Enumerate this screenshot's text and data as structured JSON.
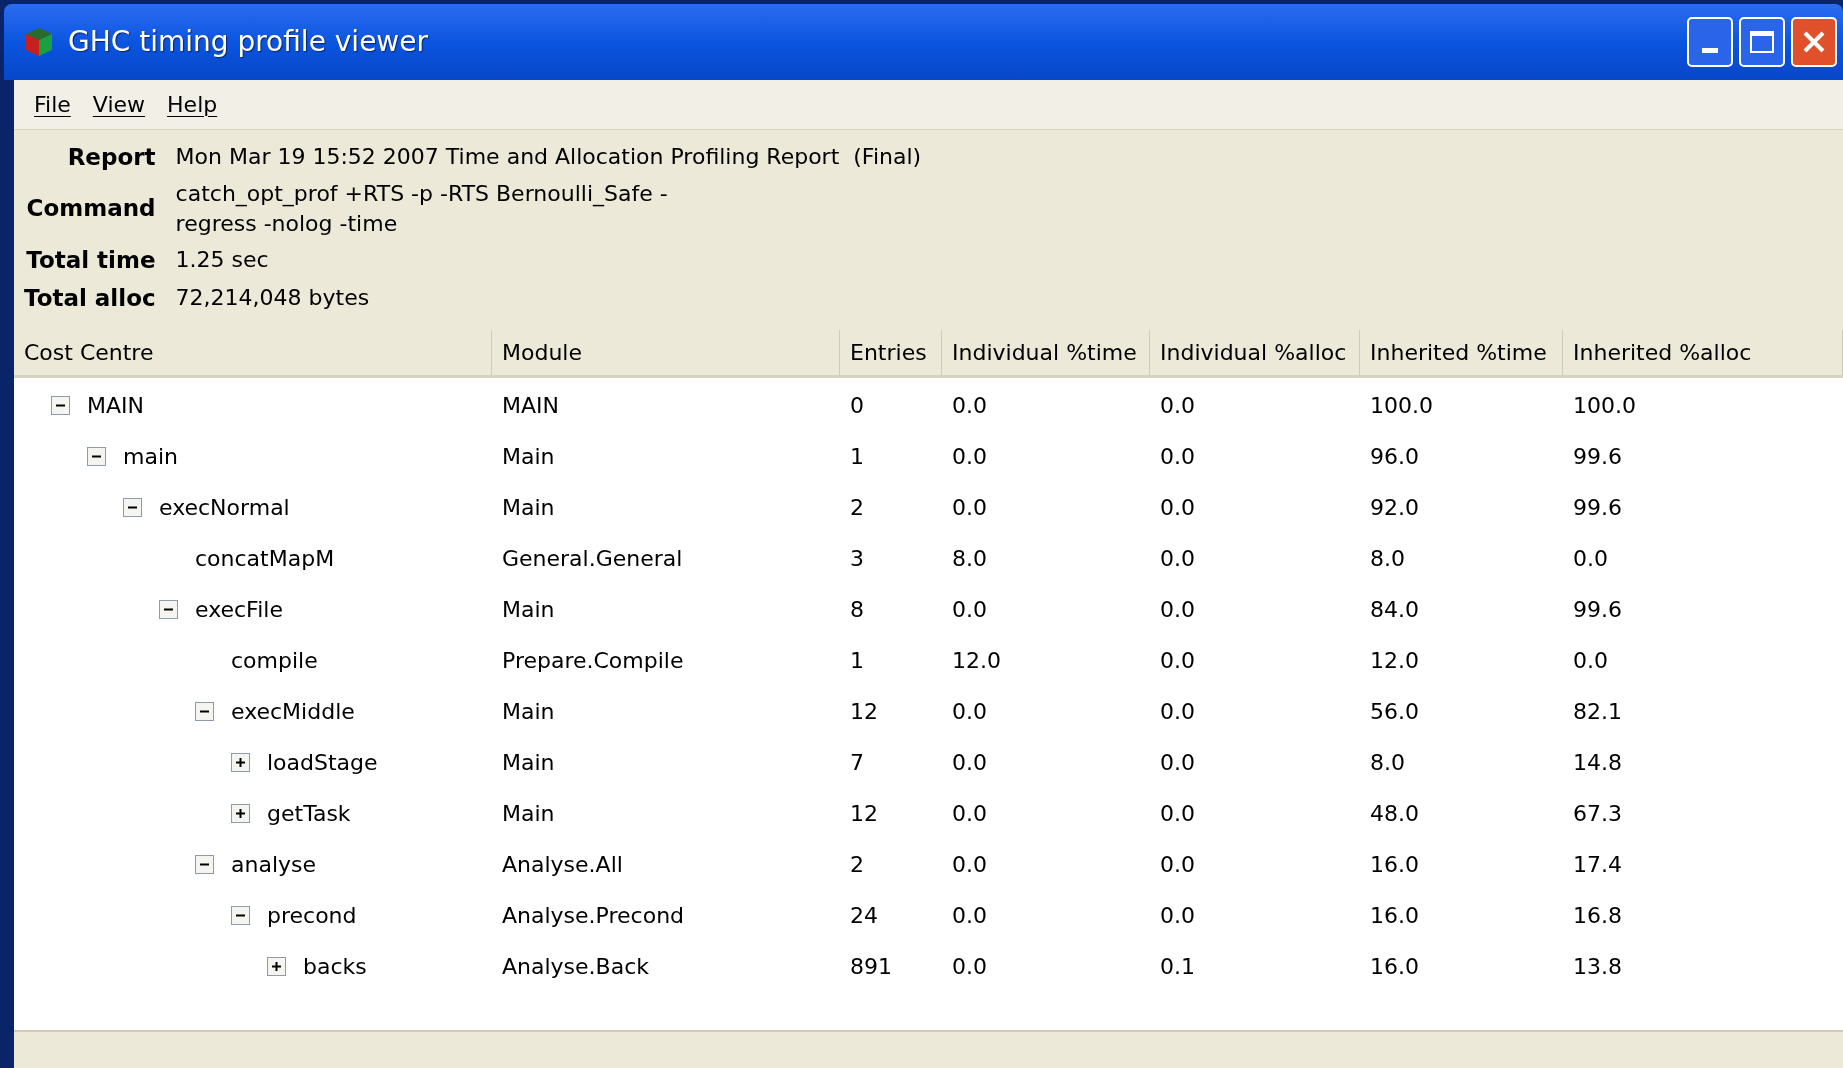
{
  "window": {
    "title": "GHC timing profile viewer"
  },
  "menu": [
    "File",
    "View",
    "Help"
  ],
  "report": [
    {
      "label": "Report",
      "value": "Mon Mar 19 15:52 2007 Time and Allocation Profiling Report  (Final)"
    },
    {
      "label": "Command",
      "value": "catch_opt_prof +RTS -p -RTS Bernoulli_Safe -\nregress -nolog -time"
    },
    {
      "label": "Total time",
      "value": "1.25 sec"
    },
    {
      "label": "Total alloc",
      "value": "72,214,048 bytes"
    }
  ],
  "table": {
    "columns": [
      "Cost Centre",
      "Module",
      "Entries",
      "Individual %time",
      "Individual %alloc",
      "Inherited %time",
      "Inherited %alloc"
    ],
    "rows": [
      {
        "cells": [
          "MAIN",
          "MAIN",
          "0",
          "0.0",
          "0.0",
          "100.0",
          "100.0"
        ],
        "expanded": true,
        "children": [
          {
            "cells": [
              "main",
              "Main",
              "1",
              "0.0",
              "0.0",
              "96.0",
              "99.6"
            ],
            "expanded": true,
            "children": [
              {
                "cells": [
                  "execNormal",
                  "Main",
                  "2",
                  "0.0",
                  "0.0",
                  "92.0",
                  "99.6"
                ],
                "expanded": true,
                "children": [
                  {
                    "cells": [
                      "concatMapM",
                      "General.General",
                      "3",
                      "8.0",
                      "0.0",
                      "8.0",
                      "0.0"
                    ]
                  },
                  {
                    "cells": [
                      "execFile",
                      "Main",
                      "8",
                      "0.0",
                      "0.0",
                      "84.0",
                      "99.6"
                    ],
                    "expanded": true,
                    "children": [
                      {
                        "cells": [
                          "compile",
                          "Prepare.Compile",
                          "1",
                          "12.0",
                          "0.0",
                          "12.0",
                          "0.0"
                        ]
                      },
                      {
                        "cells": [
                          "execMiddle",
                          "Main",
                          "12",
                          "0.0",
                          "0.0",
                          "56.0",
                          "82.1"
                        ],
                        "expanded": true,
                        "children": [
                          {
                            "cells": [
                              "loadStage",
                              "Main",
                              "7",
                              "0.0",
                              "0.0",
                              "8.0",
                              "14.8"
                            ],
                            "expanded": false
                          },
                          {
                            "cells": [
                              "getTask",
                              "Main",
                              "12",
                              "0.0",
                              "0.0",
                              "48.0",
                              "67.3"
                            ],
                            "expanded": false
                          }
                        ]
                      },
                      {
                        "cells": [
                          "analyse",
                          "Analyse.All",
                          "2",
                          "0.0",
                          "0.0",
                          "16.0",
                          "17.4"
                        ],
                        "expanded": true,
                        "children": [
                          {
                            "cells": [
                              "precond",
                              "Analyse.Precond",
                              "24",
                              "0.0",
                              "0.0",
                              "16.0",
                              "16.8"
                            ],
                            "expanded": true,
                            "children": [
                              {
                                "cells": [
                                  "backs",
                                  "Analyse.Back",
                                  "891",
                                  "0.0",
                                  "0.1",
                                  "16.0",
                                  "13.8"
                                ],
                                "expanded": false
                              }
                            ]
                          }
                        ]
                      }
                    ]
                  }
                ]
              }
            ]
          }
        ]
      }
    ]
  }
}
